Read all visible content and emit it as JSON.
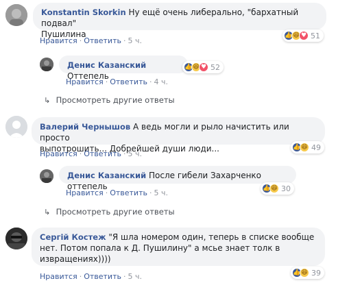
{
  "comments": [
    {
      "author": "Konstantin Skorkin",
      "text_line1": "Ну ещё очень либерально, \"бархатный подвал\"",
      "text_line2": "Пушилина",
      "like": "Нравится",
      "reply": "Ответить",
      "time": "5 ч.",
      "reactions_count": "51"
    },
    {
      "author": "Денис Казанский",
      "text": "Оттепель",
      "like": "Нравится",
      "reply": "Ответить",
      "time": "4 ч.",
      "reactions_count": "52"
    },
    {
      "more_replies": "Просмотреть другие ответы"
    },
    {
      "author": "Валерий Чернышов",
      "text_line1": "А ведь могли и рыло начистить или просто",
      "text_line2": "выпотрошить... Добрейшей души люди...",
      "like": "Нравится",
      "reply": "Ответить",
      "time": "5 ч.",
      "reactions_count": "49"
    },
    {
      "author": "Денис Казанский",
      "text": "После гибели Захарченко оттепель",
      "like": "Нравится",
      "reply": "Ответить",
      "time": "5 ч.",
      "reactions_count": "30"
    },
    {
      "more_replies": "Просмотреть другие ответы"
    },
    {
      "author": "Сергій Костеж",
      "text_line1": "\"Я шла номером один, теперь в списке вообще",
      "text_line2": "нет. Потом попала к Д. Пушилину\" а мсье знает толк в",
      "text_line3": "извращениях))))",
      "like": "Нравится",
      "reply": "Ответить",
      "time": "5 ч.",
      "reactions_count": "39"
    }
  ],
  "ui": {
    "dot": "·",
    "arrow": "↳"
  }
}
